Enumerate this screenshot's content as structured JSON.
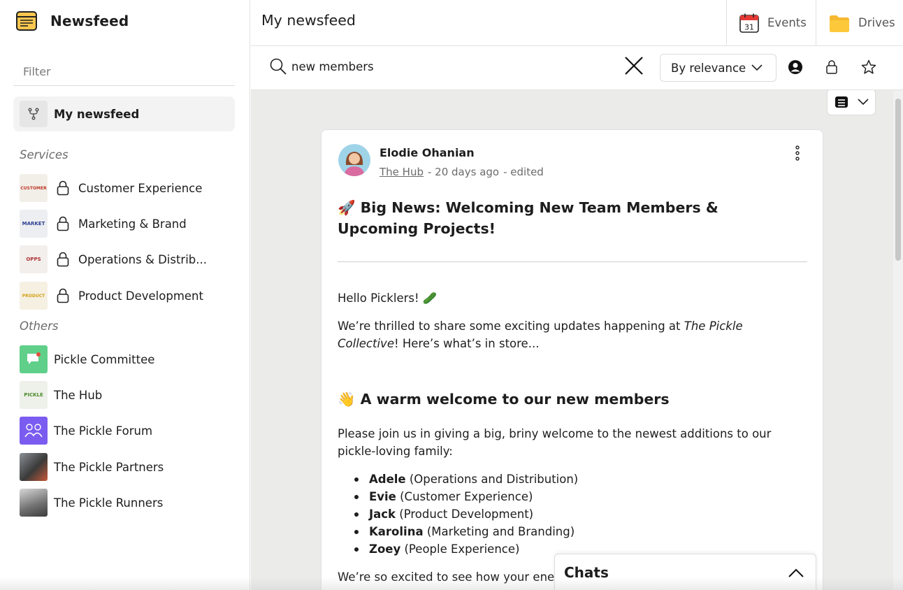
{
  "app": {
    "title": "Newsfeed"
  },
  "sidebar": {
    "filter_placeholder": "Filter",
    "active_item": {
      "label": "My newsfeed"
    },
    "services_title": "Services",
    "services": [
      {
        "label": "Customer Experience",
        "thumb_text": "CUSTOMER",
        "thumb_color": "#c0392b"
      },
      {
        "label": "Marketing & Brand",
        "thumb_text": "MARKET",
        "thumb_color": "#2c3e8f"
      },
      {
        "label": "Operations & Distrib...",
        "thumb_text": "OPPS",
        "thumb_color": "#b03030"
      },
      {
        "label": "Product Development",
        "thumb_text": "PRODUCT",
        "thumb_color": "#d4a017"
      }
    ],
    "others_title": "Others",
    "others": [
      {
        "label": "Pickle Committee"
      },
      {
        "label": "The Hub",
        "thumb_text": "PICKLE"
      },
      {
        "label": "The Pickle Forum"
      },
      {
        "label": "The Pickle Partners"
      },
      {
        "label": "The Pickle Runners"
      }
    ]
  },
  "header": {
    "page_title": "My newsfeed",
    "events_label": "Events",
    "events_day": "31",
    "drives_label": "Drives"
  },
  "search": {
    "value": "new members",
    "sort_label": "By relevance"
  },
  "post": {
    "author": "Elodie Ohanian",
    "hub": "The Hub",
    "time": "- 20 days ago",
    "edited": "- edited",
    "title": "🚀 Big News: Welcoming New Team Members & Upcoming Projects!",
    "greeting": "Hello Picklers! 🥒",
    "intro_1": "We’re thrilled to share some exciting updates happening at ",
    "intro_em": "The Pickle Collective",
    "intro_2": "! Here’s what’s in store...",
    "heading": "👋 A warm welcome to our new members",
    "welcome": "Please join us in giving a big, briny welcome to the newest additions to our pickle-loving family:",
    "members": [
      {
        "name": "Adele",
        "team": " (Operations and Distribution)"
      },
      {
        "name": "Evie",
        "team": " (Customer Experience)"
      },
      {
        "name": "Jack",
        "team": " (Product Development)"
      },
      {
        "name": "Karolina",
        "team": " (Marketing and Branding)"
      },
      {
        "name": "Zoey",
        "team": " (People Experience)"
      }
    ],
    "outro": "We’re so excited to see how your ener"
  },
  "chats": {
    "title": "Chats"
  }
}
